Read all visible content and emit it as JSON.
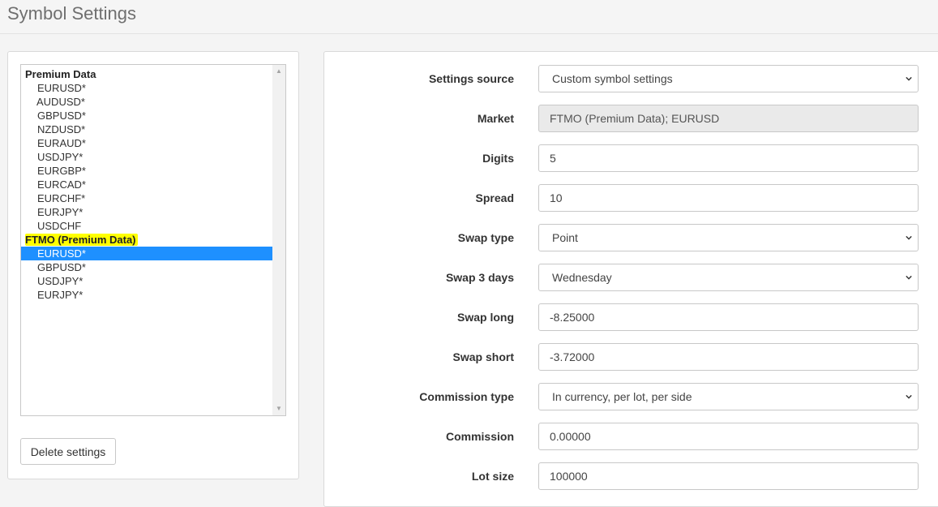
{
  "header": {
    "title": "Symbol Settings"
  },
  "symbol_list": {
    "groups": [
      {
        "label": "Premium Data",
        "highlighted": false,
        "items": [
          "EURUSD*",
          "AUDUSD*",
          "GBPUSD*",
          "NZDUSD*",
          "EURAUD*",
          "USDJPY*",
          "EURGBP*",
          "EURCAD*",
          "EURCHF*",
          "EURJPY*",
          "USDCHF"
        ]
      },
      {
        "label": "FTMO (Premium Data)",
        "highlighted": true,
        "items": [
          "EURUSD*",
          "GBPUSD*",
          "USDJPY*",
          "EURJPY*"
        ]
      }
    ],
    "selected": "FTMO (Premium Data) / EURUSD*",
    "highlight_color": "#ffff00",
    "selected_color": "#1e90ff"
  },
  "actions": {
    "delete_label": "Delete settings"
  },
  "form": {
    "settings_source": {
      "label": "Settings source",
      "value": "Custom symbol settings"
    },
    "market": {
      "label": "Market",
      "value": "FTMO (Premium Data); EURUSD"
    },
    "digits": {
      "label": "Digits",
      "value": "5"
    },
    "spread": {
      "label": "Spread",
      "value": "10"
    },
    "swap_type": {
      "label": "Swap type",
      "value": "Point"
    },
    "swap_3_days": {
      "label": "Swap 3 days",
      "value": "Wednesday"
    },
    "swap_long": {
      "label": "Swap long",
      "value": "-8.25000"
    },
    "swap_short": {
      "label": "Swap short",
      "value": "-3.72000"
    },
    "commission_type": {
      "label": "Commission type",
      "value": "In currency, per lot, per side"
    },
    "commission": {
      "label": "Commission",
      "value": "0.00000"
    },
    "lot_size": {
      "label": "Lot size",
      "value": "100000"
    }
  }
}
